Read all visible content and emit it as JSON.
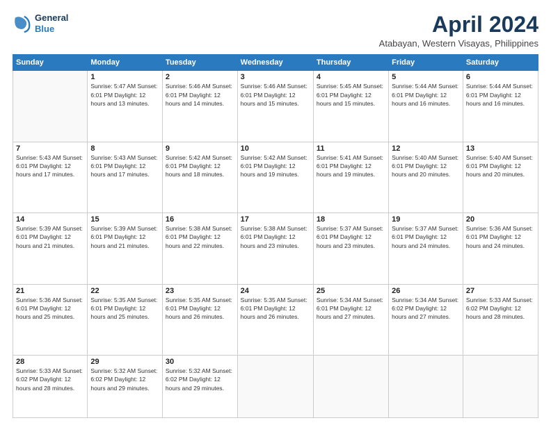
{
  "header": {
    "logo_line1": "General",
    "logo_line2": "Blue",
    "title": "April 2024",
    "subtitle": "Atabayan, Western Visayas, Philippines"
  },
  "columns": [
    "Sunday",
    "Monday",
    "Tuesday",
    "Wednesday",
    "Thursday",
    "Friday",
    "Saturday"
  ],
  "weeks": [
    [
      {
        "num": "",
        "info": ""
      },
      {
        "num": "1",
        "info": "Sunrise: 5:47 AM\nSunset: 6:01 PM\nDaylight: 12 hours\nand 13 minutes."
      },
      {
        "num": "2",
        "info": "Sunrise: 5:46 AM\nSunset: 6:01 PM\nDaylight: 12 hours\nand 14 minutes."
      },
      {
        "num": "3",
        "info": "Sunrise: 5:46 AM\nSunset: 6:01 PM\nDaylight: 12 hours\nand 15 minutes."
      },
      {
        "num": "4",
        "info": "Sunrise: 5:45 AM\nSunset: 6:01 PM\nDaylight: 12 hours\nand 15 minutes."
      },
      {
        "num": "5",
        "info": "Sunrise: 5:44 AM\nSunset: 6:01 PM\nDaylight: 12 hours\nand 16 minutes."
      },
      {
        "num": "6",
        "info": "Sunrise: 5:44 AM\nSunset: 6:01 PM\nDaylight: 12 hours\nand 16 minutes."
      }
    ],
    [
      {
        "num": "7",
        "info": "Sunrise: 5:43 AM\nSunset: 6:01 PM\nDaylight: 12 hours\nand 17 minutes."
      },
      {
        "num": "8",
        "info": "Sunrise: 5:43 AM\nSunset: 6:01 PM\nDaylight: 12 hours\nand 17 minutes."
      },
      {
        "num": "9",
        "info": "Sunrise: 5:42 AM\nSunset: 6:01 PM\nDaylight: 12 hours\nand 18 minutes."
      },
      {
        "num": "10",
        "info": "Sunrise: 5:42 AM\nSunset: 6:01 PM\nDaylight: 12 hours\nand 19 minutes."
      },
      {
        "num": "11",
        "info": "Sunrise: 5:41 AM\nSunset: 6:01 PM\nDaylight: 12 hours\nand 19 minutes."
      },
      {
        "num": "12",
        "info": "Sunrise: 5:40 AM\nSunset: 6:01 PM\nDaylight: 12 hours\nand 20 minutes."
      },
      {
        "num": "13",
        "info": "Sunrise: 5:40 AM\nSunset: 6:01 PM\nDaylight: 12 hours\nand 20 minutes."
      }
    ],
    [
      {
        "num": "14",
        "info": "Sunrise: 5:39 AM\nSunset: 6:01 PM\nDaylight: 12 hours\nand 21 minutes."
      },
      {
        "num": "15",
        "info": "Sunrise: 5:39 AM\nSunset: 6:01 PM\nDaylight: 12 hours\nand 21 minutes."
      },
      {
        "num": "16",
        "info": "Sunrise: 5:38 AM\nSunset: 6:01 PM\nDaylight: 12 hours\nand 22 minutes."
      },
      {
        "num": "17",
        "info": "Sunrise: 5:38 AM\nSunset: 6:01 PM\nDaylight: 12 hours\nand 23 minutes."
      },
      {
        "num": "18",
        "info": "Sunrise: 5:37 AM\nSunset: 6:01 PM\nDaylight: 12 hours\nand 23 minutes."
      },
      {
        "num": "19",
        "info": "Sunrise: 5:37 AM\nSunset: 6:01 PM\nDaylight: 12 hours\nand 24 minutes."
      },
      {
        "num": "20",
        "info": "Sunrise: 5:36 AM\nSunset: 6:01 PM\nDaylight: 12 hours\nand 24 minutes."
      }
    ],
    [
      {
        "num": "21",
        "info": "Sunrise: 5:36 AM\nSunset: 6:01 PM\nDaylight: 12 hours\nand 25 minutes."
      },
      {
        "num": "22",
        "info": "Sunrise: 5:35 AM\nSunset: 6:01 PM\nDaylight: 12 hours\nand 25 minutes."
      },
      {
        "num": "23",
        "info": "Sunrise: 5:35 AM\nSunset: 6:01 PM\nDaylight: 12 hours\nand 26 minutes."
      },
      {
        "num": "24",
        "info": "Sunrise: 5:35 AM\nSunset: 6:01 PM\nDaylight: 12 hours\nand 26 minutes."
      },
      {
        "num": "25",
        "info": "Sunrise: 5:34 AM\nSunset: 6:01 PM\nDaylight: 12 hours\nand 27 minutes."
      },
      {
        "num": "26",
        "info": "Sunrise: 5:34 AM\nSunset: 6:02 PM\nDaylight: 12 hours\nand 27 minutes."
      },
      {
        "num": "27",
        "info": "Sunrise: 5:33 AM\nSunset: 6:02 PM\nDaylight: 12 hours\nand 28 minutes."
      }
    ],
    [
      {
        "num": "28",
        "info": "Sunrise: 5:33 AM\nSunset: 6:02 PM\nDaylight: 12 hours\nand 28 minutes."
      },
      {
        "num": "29",
        "info": "Sunrise: 5:32 AM\nSunset: 6:02 PM\nDaylight: 12 hours\nand 29 minutes."
      },
      {
        "num": "30",
        "info": "Sunrise: 5:32 AM\nSunset: 6:02 PM\nDaylight: 12 hours\nand 29 minutes."
      },
      {
        "num": "",
        "info": ""
      },
      {
        "num": "",
        "info": ""
      },
      {
        "num": "",
        "info": ""
      },
      {
        "num": "",
        "info": ""
      }
    ]
  ]
}
